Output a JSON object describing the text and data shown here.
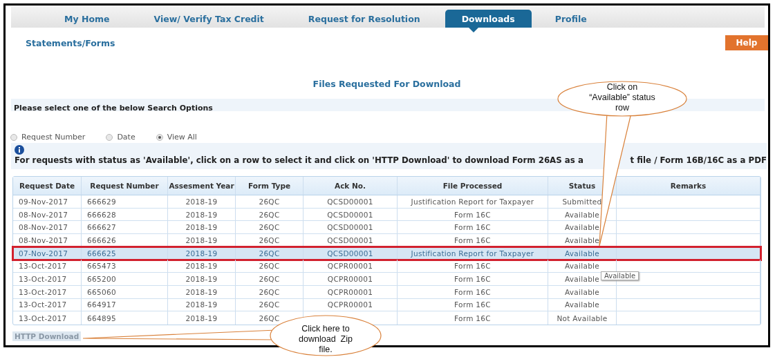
{
  "nav": {
    "tabs": [
      {
        "label": "My Home",
        "selected": false
      },
      {
        "label": "View/ Verify Tax Credit",
        "selected": false
      },
      {
        "label": "Request for Resolution",
        "selected": false
      },
      {
        "label": "Downloads",
        "selected": true
      },
      {
        "label": "Profile",
        "selected": false
      }
    ]
  },
  "subnav": {
    "link": "Statements/Forms"
  },
  "help_button": "Help",
  "page_title": "Files Requested For Download",
  "search_options": {
    "heading": "Please select one of the below Search Options",
    "options": [
      {
        "label": "Request Number",
        "selected": false
      },
      {
        "label": "Date",
        "selected": false
      },
      {
        "label": "View All",
        "selected": true
      }
    ]
  },
  "info": {
    "text_parts": [
      "For requests with status as 'Available', click on a row to select it and click on 'HTTP Download' to download Form 26AS as a",
      "t file / Form 16B/16C as a PDF"
    ]
  },
  "table": {
    "columns": [
      "Request Date",
      "Request Number",
      "Assesment Year",
      "Form Type",
      "Ack No.",
      "File Processed",
      "Status",
      "Remarks"
    ],
    "rows": [
      {
        "cells": [
          "09-Nov-2017",
          "666629",
          "2018-19",
          "26QC",
          "QCSD00001",
          "Justification Report for Taxpayer",
          "Submitted"
        ],
        "selected": false
      },
      {
        "cells": [
          "08-Nov-2017",
          "666628",
          "2018-19",
          "26QC",
          "QCSD00001",
          "Form 16C",
          "Available"
        ],
        "selected": false
      },
      {
        "cells": [
          "08-Nov-2017",
          "666627",
          "2018-19",
          "26QC",
          "QCSD00001",
          "Form 16C",
          "Available"
        ],
        "selected": false
      },
      {
        "cells": [
          "08-Nov-2017",
          "666626",
          "2018-19",
          "26QC",
          "QCSD00001",
          "Form 16C",
          "Available"
        ],
        "selected": false
      },
      {
        "cells": [
          "07-Nov-2017",
          "666625",
          "2018-19",
          "26QC",
          "QCSD00001",
          "Justification Report for Taxpayer",
          "Available"
        ],
        "selected": true
      },
      {
        "cells": [
          "13-Oct-2017",
          "665473",
          "2018-19",
          "26QC",
          "QCPR00001",
          "Form 16C",
          "Available"
        ],
        "selected": false
      },
      {
        "cells": [
          "13-Oct-2017",
          "665200",
          "2018-19",
          "26QC",
          "QCPR00001",
          "Form 16C",
          "Available"
        ],
        "selected": false
      },
      {
        "cells": [
          "13-Oct-2017",
          "665060",
          "2018-19",
          "26QC",
          "QCPR00001",
          "Form 16C",
          "Available"
        ],
        "selected": false
      },
      {
        "cells": [
          "13-Oct-2017",
          "664917",
          "2018-19",
          "26QC",
          "QCPR00001",
          "Form 16C",
          "Available"
        ],
        "selected": false
      },
      {
        "cells": [
          "13-Oct-2017",
          "664895",
          "2018-19",
          "26QC",
          null,
          "Form 16C",
          "Not Available"
        ],
        "selected": false
      }
    ]
  },
  "tooltip": "Available",
  "http_download": "HTTP Download",
  "callouts": [
    {
      "lines": [
        "Click on",
        "“Available” status",
        "row"
      ]
    },
    {
      "lines": [
        "Click here to",
        "download  Zip",
        "file."
      ]
    }
  ]
}
